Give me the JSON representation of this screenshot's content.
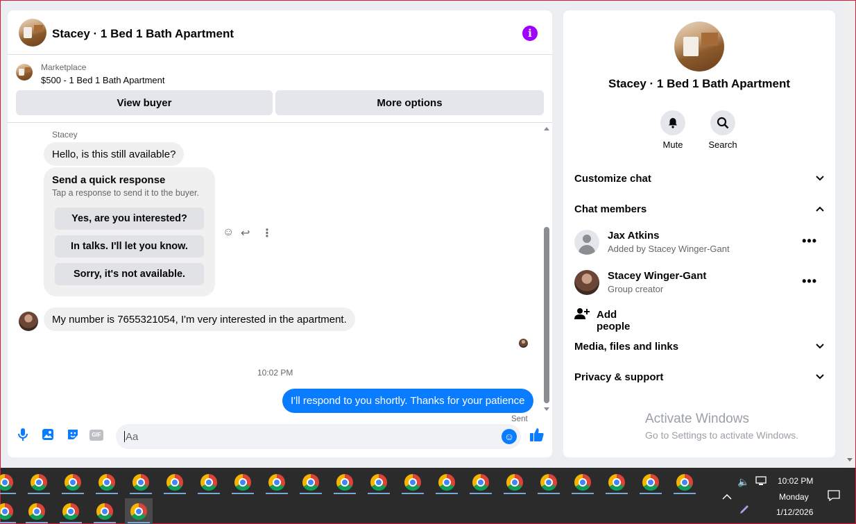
{
  "header": {
    "title": "Stacey · 1 Bed 1 Bath Apartment"
  },
  "listing": {
    "source": "Marketplace",
    "title": "$500 - 1 Bed 1 Bath Apartment",
    "view_buyer_label": "View buyer",
    "more_options_label": "More options"
  },
  "messages": {
    "sender_name": "Stacey",
    "first_message": "Hello, is this still available?",
    "quick_response": {
      "title": "Send a quick response",
      "subtitle": "Tap a response to send it to the buyer.",
      "options": [
        "Yes, are you interested?",
        "In talks. I'll let you know.",
        "Sorry, it's not available."
      ]
    },
    "second_message": "My number is 7655321054, I'm very interested in the apartment.",
    "timestamp": "10:02 PM",
    "outgoing_message": "I'll respond to you shortly. Thanks for your patience",
    "status": "Sent"
  },
  "composer": {
    "placeholder": "Aa",
    "gif_label": "GIF"
  },
  "right_panel": {
    "title": "Stacey · 1 Bed 1 Bath Apartment",
    "mute_label": "Mute",
    "search_label": "Search",
    "customize_chat": "Customize chat",
    "chat_members": "Chat members",
    "members": [
      {
        "name": "Jax Atkins",
        "role": "Added by Stacey Winger-Gant"
      },
      {
        "name": "Stacey Winger-Gant",
        "role": "Group creator"
      }
    ],
    "add_people": "Add people",
    "media_files_links": "Media, files and links",
    "privacy_support": "Privacy & support"
  },
  "watermark": {
    "title": "Activate Windows",
    "subtitle": "Go to Settings to activate Windows."
  },
  "taskbar": {
    "time": "10:02 PM",
    "day": "Monday",
    "date": "1/12/2026"
  },
  "colors": {
    "accent": "#0a7cff",
    "info": "#a100ff",
    "taskbar": "#2b2b2b"
  }
}
